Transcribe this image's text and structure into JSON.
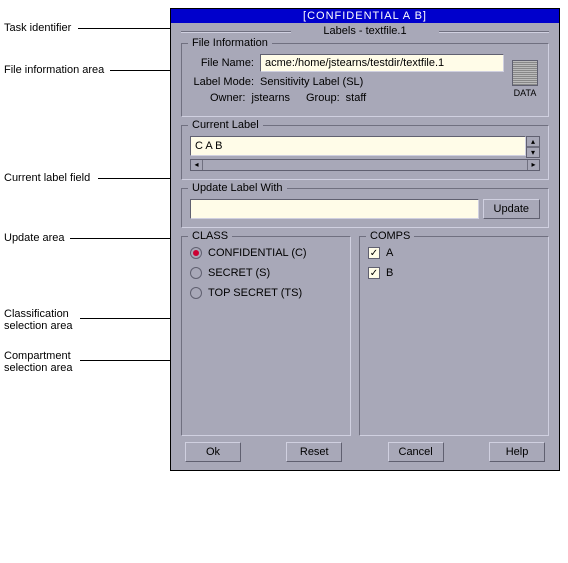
{
  "callouts": {
    "task_identifier": "Task identifier",
    "file_info_area": "File information area",
    "current_label_field": "Current label field",
    "update_area": "Update area",
    "classification_area": "Classification\nselection area",
    "compartment_area": "Compartment\nselection area"
  },
  "titlebar": "[CONFIDENTIAL A B]",
  "task_line": "Labels - textfile.1",
  "fileinfo": {
    "legend": "File Information",
    "filename_label": "File Name:",
    "filename_value": "acme:/home/jstearns/testdir/textfile.1",
    "labelmode_label": "Label Mode:",
    "labelmode_value": "Sensitivity Label (SL)",
    "owner_label": "Owner:",
    "owner_value": "jstearns",
    "group_label": "Group:",
    "group_value": "staff",
    "data_badge": "DATA"
  },
  "current": {
    "legend": "Current Label",
    "value": "C A B"
  },
  "update": {
    "legend": "Update Label With",
    "value": "",
    "button": "Update"
  },
  "class_panel": {
    "legend": "CLASS",
    "options": [
      {
        "label": "CONFIDENTIAL (C)",
        "selected": true
      },
      {
        "label": "SECRET (S)",
        "selected": false
      },
      {
        "label": "TOP SECRET (TS)",
        "selected": false
      }
    ]
  },
  "comps_panel": {
    "legend": "COMPS",
    "options": [
      {
        "label": "A",
        "checked": true
      },
      {
        "label": "B",
        "checked": true
      }
    ]
  },
  "buttons": {
    "ok": "Ok",
    "reset": "Reset",
    "cancel": "Cancel",
    "help": "Help"
  }
}
